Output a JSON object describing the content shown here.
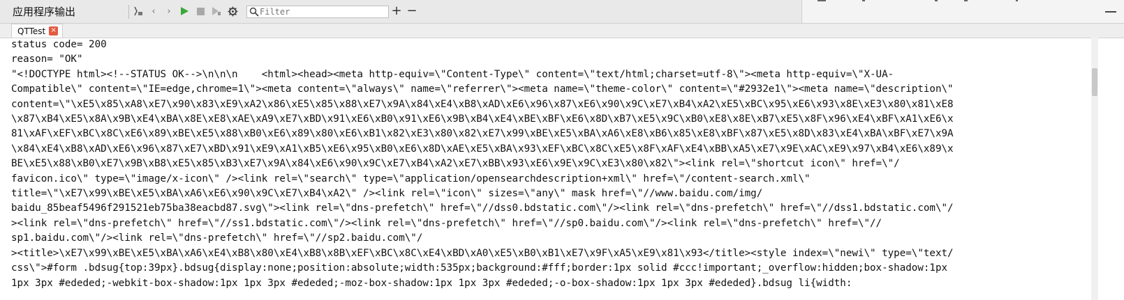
{
  "panel": {
    "title": "应用程序输出"
  },
  "toolbar": {
    "filter_placeholder": "Filter",
    "filter_value": "",
    "plus_label": "+",
    "minus_label": "−"
  },
  "tabs": [
    {
      "label": "QTTest",
      "close": "×"
    }
  ],
  "output_lines": [
    "status code= 200",
    "reason= \"OK\"",
    "\"<!DOCTYPE html><!--STATUS OK-->\\n\\n\\n    <html><head><meta http-equiv=\\\"Content-Type\\\" content=\\\"text/html;charset=utf-8\\\"><meta http-equiv=\\\"X-UA-",
    "Compatible\\\" content=\\\"IE=edge,chrome=1\\\"><meta content=\\\"always\\\" name=\\\"referrer\\\"><meta name=\\\"theme-color\\\" content=\\\"#2932e1\\\"><meta name=\\\"description\\\"",
    "content=\\\"\\xE5\\x85\\xA8\\xE7\\x90\\x83\\xE9\\xA2\\x86\\xE5\\x85\\x88\\xE7\\x9A\\x84\\xE4\\xB8\\xAD\\xE6\\x96\\x87\\xE6\\x90\\x9C\\xE7\\xB4\\xA2\\xE5\\xBC\\x95\\xE6\\x93\\x8E\\xE3\\x80\\x81\\xE8",
    "\\x87\\xB4\\xE5\\x8A\\x9B\\xE4\\xBA\\x8E\\xE8\\xAE\\xA9\\xE7\\xBD\\x91\\xE6\\xB0\\x91\\xE6\\x9B\\xB4\\xE4\\xBE\\xBF\\xE6\\x8D\\xB7\\xE5\\x9C\\xB0\\xE8\\x8E\\xB7\\xE5\\x8F\\x96\\xE4\\xBF\\xA1\\xE6\\x",
    "81\\xAF\\xEF\\xBC\\x8C\\xE6\\x89\\xBE\\xE5\\x88\\xB0\\xE6\\x89\\x80\\xE6\\xB1\\x82\\xE3\\x80\\x82\\xE7\\x99\\xBE\\xE5\\xBA\\xA6\\xE8\\xB6\\x85\\xE8\\xBF\\x87\\xE5\\x8D\\x83\\xE4\\xBA\\xBF\\xE7\\x9A",
    "\\x84\\xE4\\xB8\\xAD\\xE6\\x96\\x87\\xE7\\xBD\\x91\\xE9\\xA1\\xB5\\xE6\\x95\\xB0\\xE6\\x8D\\xAE\\xE5\\xBA\\x93\\xEF\\xBC\\x8C\\xE5\\x8F\\xAF\\xE4\\xBB\\xA5\\xE7\\x9E\\xAC\\xE9\\x97\\xB4\\xE6\\x89\\x",
    "BE\\xE5\\x88\\xB0\\xE7\\x9B\\xB8\\xE5\\x85\\xB3\\xE7\\x9A\\x84\\xE6\\x90\\x9C\\xE7\\xB4\\xA2\\xE7\\xBB\\x93\\xE6\\x9E\\x9C\\xE3\\x80\\x82\\\"><link rel=\\\"shortcut icon\\\" href=\\\"/",
    "favicon.ico\\\" type=\\\"image/x-icon\\\" /><link rel=\\\"search\\\" type=\\\"application/opensearchdescription+xml\\\" href=\\\"/content-search.xml\\\"",
    "title=\\\"\\xE7\\x99\\xBE\\xE5\\xBA\\xA6\\xE6\\x90\\x9C\\xE7\\xB4\\xA2\\\" /><link rel=\\\"icon\\\" sizes=\\\"any\\\" mask href=\\\"//www.baidu.com/img/",
    "baidu_85beaf5496f291521eb75ba38eacbd87.svg\\\"><link rel=\\\"dns-prefetch\\\" href=\\\"//dss0.bdstatic.com\\\"/><link rel=\\\"dns-prefetch\\\" href=\\\"//dss1.bdstatic.com\\\"/",
    "><link rel=\\\"dns-prefetch\\\" href=\\\"//ss1.bdstatic.com\\\"/><link rel=\\\"dns-prefetch\\\" href=\\\"//sp0.baidu.com\\\"/><link rel=\\\"dns-prefetch\\\" href=\\\"//",
    "sp1.baidu.com\\\"/><link rel=\\\"dns-prefetch\\\" href=\\\"//sp2.baidu.com\\\"/",
    "><title>\\xE7\\x99\\xBE\\xE5\\xBA\\xA6\\xE4\\xB8\\x80\\xE4\\xB8\\x8B\\xEF\\xBC\\x8C\\xE4\\xBD\\xA0\\xE5\\xB0\\xB1\\xE7\\x9F\\xA5\\xE9\\x81\\x93</title><style index=\\\"newi\\\" type=\\\"text/",
    "css\\\">#form .bdsug{top:39px}.bdsug{display:none;position:absolute;width:535px;background:#fff;border:1px solid #ccc!important;_overflow:hidden;box-shadow:1px",
    "1px 3px #ededed;-webkit-box-shadow:1px 1px 3px #ededed;-moz-box-shadow:1px 1px 3px #ededed;-o-box-shadow:1px 1px 3px #ededed}.bdsug li{width:"
  ]
}
